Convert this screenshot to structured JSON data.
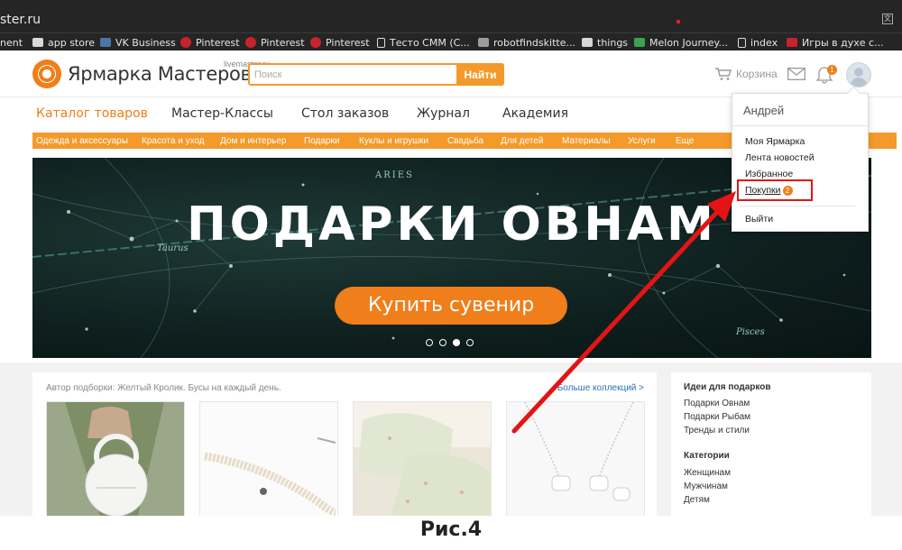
{
  "browser": {
    "url_text": "ster.ru",
    "bookmarks": [
      {
        "label": "nent",
        "icon": "none"
      },
      {
        "label": "app store",
        "icon": "folder-icon"
      },
      {
        "label": "VK Business",
        "icon": "vk-icon"
      },
      {
        "label": "Pinterest",
        "icon": "pinterest-icon"
      },
      {
        "label": "Pinterest",
        "icon": "pinterest-icon"
      },
      {
        "label": "Pinterest",
        "icon": "pinterest-icon"
      },
      {
        "label": "Тесто СММ (С...",
        "icon": "document-icon"
      },
      {
        "label": "robotfindskitte...",
        "icon": "puzzle-icon"
      },
      {
        "label": "things",
        "icon": "folder-icon"
      },
      {
        "label": "Melon Journey...",
        "icon": "melon-icon"
      },
      {
        "label": "index",
        "icon": "document-icon"
      },
      {
        "label": "Игры в духе с...",
        "icon": "red-icon"
      }
    ]
  },
  "header": {
    "logo_text": "Ярмарка Мастеров",
    "logo_domain": "livemaster.ru",
    "search_placeholder": "Поиск",
    "search_button": "Найти",
    "cart_label": "Корзина",
    "notifications_count": "1"
  },
  "main_nav": [
    {
      "label": "Каталог товаров",
      "active": true
    },
    {
      "label": "Мастер-Классы",
      "active": false
    },
    {
      "label": "Стол заказов",
      "active": false
    },
    {
      "label": "Журнал",
      "active": false
    },
    {
      "label": "Академия",
      "active": false
    }
  ],
  "category_nav": [
    "Одежда и аксессуары",
    "Красота и уход",
    "Дом и интерьер",
    "Подарки",
    "Куклы и игрушки",
    "Свадьба",
    "Для детей",
    "Материалы",
    "Услуги",
    "Еще"
  ],
  "banner": {
    "title": "ПОДАРКИ ОВНАМ",
    "button": "Купить сувенир",
    "constellation_labels": [
      "ARIES",
      "Taurus",
      "Pisces"
    ],
    "slide_count": 4,
    "active_slide": 3
  },
  "collection": {
    "author_line": "Автор подборки: Желтый Кролик. Бусы на каждый день.",
    "more_link": "Больше коллекций >"
  },
  "sidebar": {
    "ideas_title": "Идеи для подарков",
    "ideas": [
      "Подарки Овнам",
      "Подарки Рыбам",
      "Тренды и стили"
    ],
    "categories_title": "Категории",
    "categories": [
      "Женщинам",
      "Мужчинам",
      "Детям"
    ]
  },
  "dropdown": {
    "user_name": "Андрей",
    "items": [
      "Моя Ярмарка",
      "Лента новостей",
      "Избранное"
    ],
    "purchases_label": "Покупки",
    "purchases_count": "2",
    "logout": "Выйти"
  },
  "caption": "Рис.4",
  "colors": {
    "accent": "#f39a2b",
    "brand_orange": "#f07e1a",
    "annotation_red": "#e41414",
    "link_blue": "#2d6fba"
  }
}
